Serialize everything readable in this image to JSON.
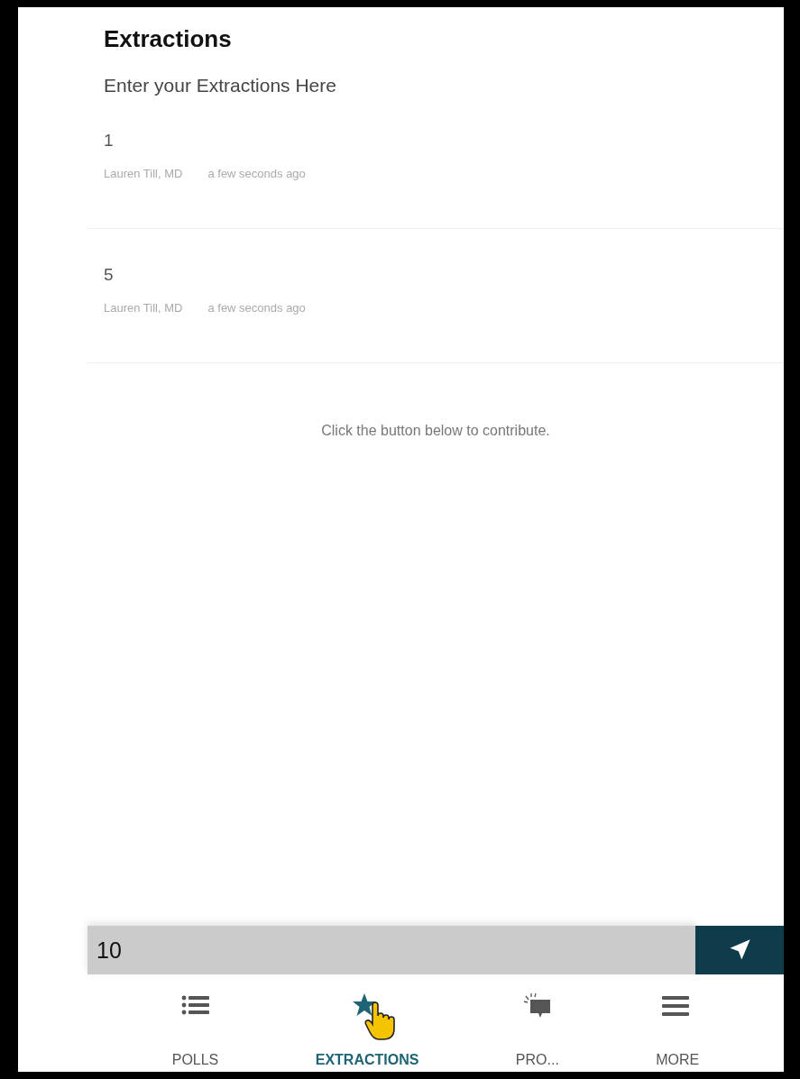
{
  "header": {
    "title": "Extractions",
    "subtitle": "Enter your Extractions Here"
  },
  "entries": [
    {
      "value": "1",
      "author": "Lauren Till, MD",
      "time": "a few seconds ago"
    },
    {
      "value": "5",
      "author": "Lauren Till, MD",
      "time": "a few seconds ago"
    }
  ],
  "empty_hint": "Click the button below to contribute.",
  "composer": {
    "value": "10"
  },
  "nav": [
    {
      "kind": "list",
      "label": "POLLS",
      "selected": false
    },
    {
      "kind": "star",
      "label": "EXTRACTIONS",
      "selected": true
    },
    {
      "kind": "speech",
      "label": "PRO...",
      "selected": false
    },
    {
      "kind": "menu",
      "label": "MORE",
      "selected": false
    }
  ]
}
